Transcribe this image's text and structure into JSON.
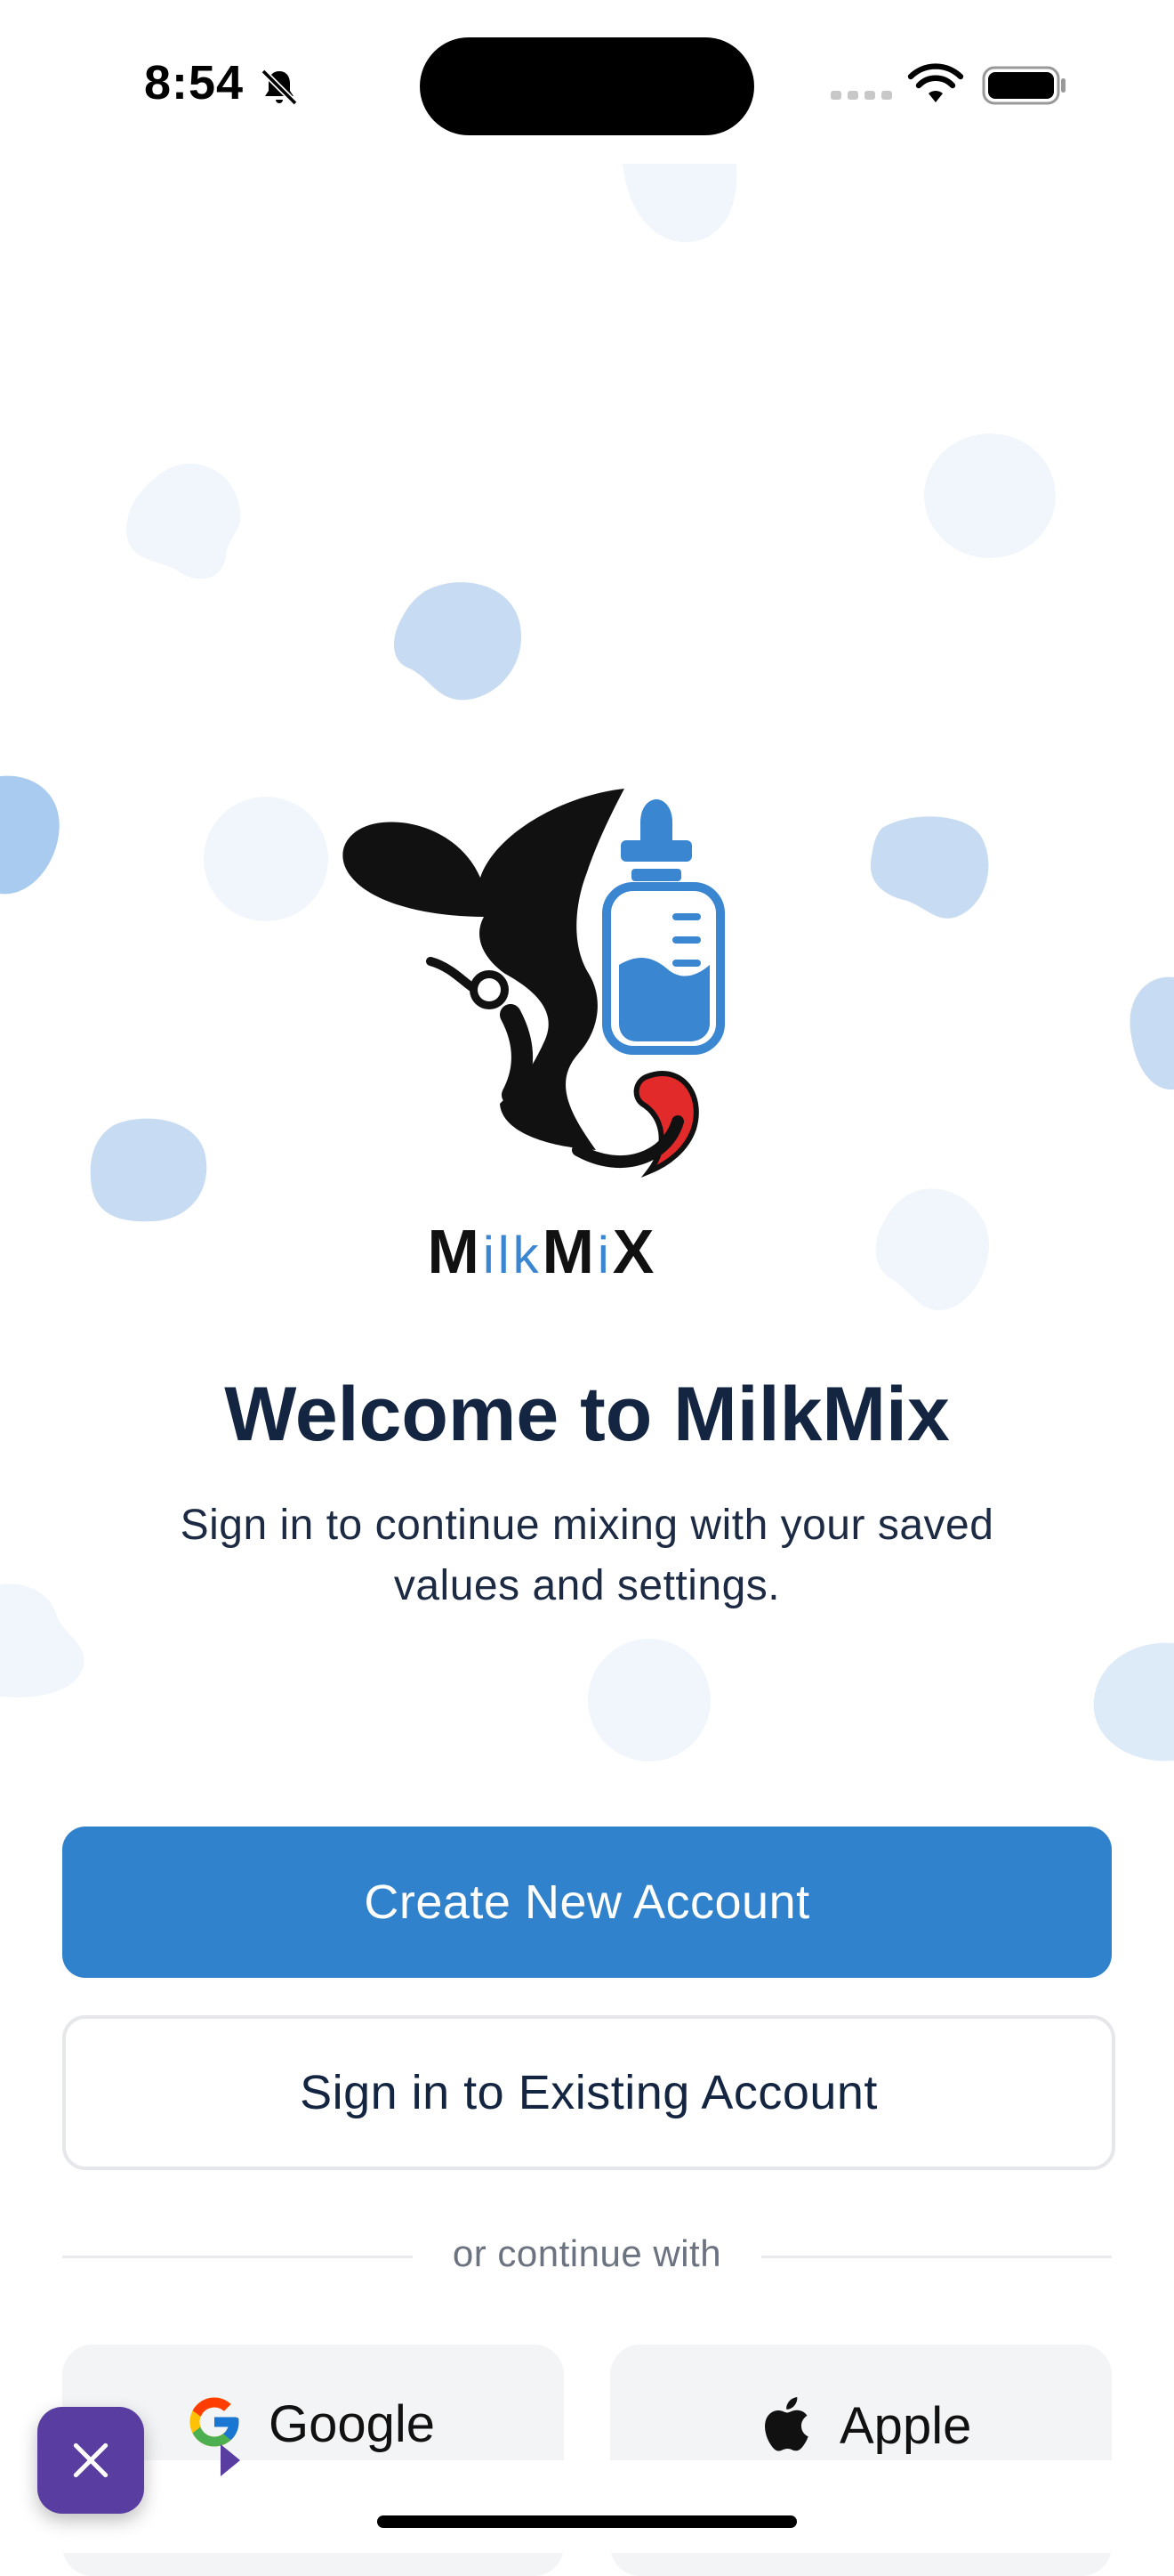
{
  "status_bar": {
    "time": "8:54"
  },
  "logo": {
    "wordmark_parts": [
      "M",
      "ilk",
      "M",
      "i",
      "X"
    ]
  },
  "welcome": {
    "title": "Welcome to MilkMix",
    "subtitle": "Sign in to continue mixing with your saved values and settings."
  },
  "actions": {
    "create_label": "Create New Account",
    "signin_label": "Sign in to Existing Account",
    "divider_text": "or continue with",
    "google_label": "Google",
    "apple_label": "Apple"
  },
  "colors": {
    "primary": "#3082cc",
    "title": "#132541",
    "accent_red": "#e32a2a",
    "bottle_blue": "#3a86d1",
    "dismiss": "#5a3da0"
  },
  "icons": [
    "bell-slash-icon",
    "signal-icon",
    "wifi-icon",
    "battery-icon",
    "google-icon",
    "apple-icon",
    "close-icon"
  ]
}
